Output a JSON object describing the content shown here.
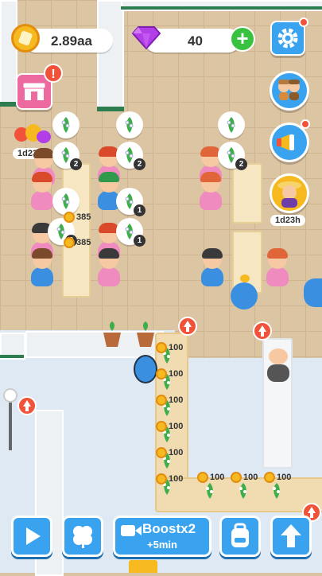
{
  "hud": {
    "coins": "2.89aa",
    "gems": "40",
    "shop_alert": "!",
    "character_timer": "1d23h",
    "order_timer": "1d23h"
  },
  "customers": [
    {
      "hair": "#7a4a2a",
      "shirt": "#f08bc0"
    },
    {
      "hair": "#d94a2a",
      "shirt": "#f08bc0"
    },
    {
      "hair": "#2f9a4a",
      "shirt": "#3a8fe0"
    },
    {
      "hair": "#e0663a",
      "shirt": "#f08bc0"
    },
    {
      "hair": "#d94a2a",
      "shirt": "#f08bc0"
    },
    {
      "hair": "#e0663a",
      "shirt": "#f08bc0"
    },
    {
      "hair": "#3a3a3a",
      "shirt": "#f08bc0"
    },
    {
      "hair": "#d94a2a",
      "shirt": "#f08bc0"
    },
    {
      "hair": "#7a4a2a",
      "shirt": "#3a8fe0"
    },
    {
      "hair": "#3a3a3a",
      "shirt": "#f08bc0"
    },
    {
      "hair": "#3a3a3a",
      "shirt": "#3a8fe0"
    },
    {
      "hair": "#e0663a",
      "shirt": "#f08bc0"
    }
  ],
  "bubbles": {
    "count_a": "2",
    "count_b": "2",
    "count_c": "2",
    "count_d": "2",
    "count_e": "1",
    "count_f": "1"
  },
  "earnings": {
    "left_a": "385",
    "left_b": "385",
    "shelf_values": [
      "100",
      "100",
      "100",
      "100",
      "100",
      "100"
    ],
    "bottom_values": [
      "100",
      "100",
      "100"
    ]
  },
  "bottom_bar": {
    "boost_label": "Boostx2",
    "boost_sub": "+5min"
  },
  "colors": {
    "accent_blue": "#3aa3ef",
    "alert_red": "#f0533a",
    "coin_gold": "#f6b91f",
    "gem_purple": "#b13ee6",
    "plus_green": "#39c23f"
  },
  "icons": {
    "coin": "coin-icon",
    "gem": "gem-icon",
    "settings": "gear-icon",
    "shop": "shop-icon",
    "play": "play-icon",
    "clover": "clover-icon",
    "video": "video-icon",
    "backpack": "backpack-icon",
    "upgrade": "up-arrow-icon",
    "megaphone": "megaphone-icon"
  }
}
